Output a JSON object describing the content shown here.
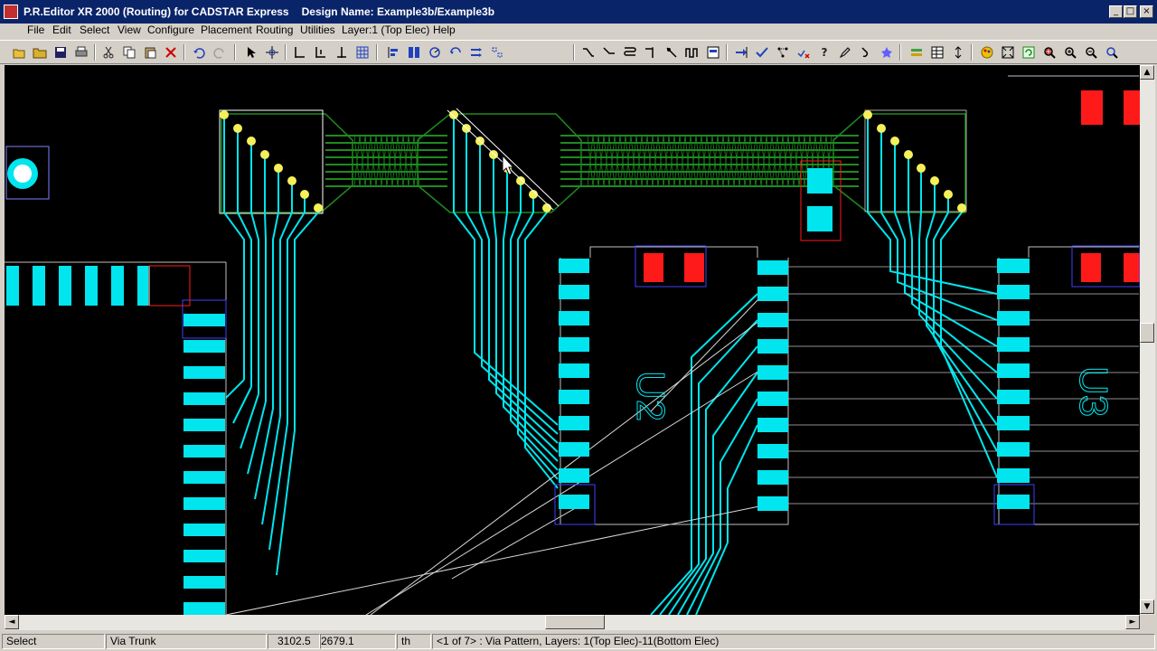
{
  "window": {
    "title": "P.R.Editor XR 2000 (Routing) for CADSTAR Express",
    "design_label": "Design Name: Example3b/Example3b",
    "minimize": "_",
    "maximize": "□",
    "close": "×"
  },
  "menu": [
    {
      "label": "File"
    },
    {
      "label": "Edit"
    },
    {
      "label": "Select"
    },
    {
      "label": "View"
    },
    {
      "label": "Configure"
    },
    {
      "label": "Placement"
    },
    {
      "label": "Routing"
    },
    {
      "label": "Utilities"
    },
    {
      "label": "Layer:1 (Top Elec)"
    },
    {
      "label": "Help"
    }
  ],
  "toolbar_icons": [
    "open-icon",
    "folder-icon",
    "save-icon",
    "print-icon",
    "cut-icon",
    "copy-icon",
    "paste-icon",
    "delete-icon",
    "undo-icon",
    "redo-icon",
    "select-arrow-icon",
    "move-icon",
    "dimension-icon",
    "dimension2-icon",
    "dimension3-icon",
    "grid-icon",
    "align-icon",
    "distribute-icon",
    "rotate-icon",
    "mirror-icon",
    "swap-icon",
    "group-icon",
    "route-icon",
    "route-angle-icon",
    "bus-route-icon",
    "corner-icon",
    "pushpin-icon",
    "meander-icon",
    "pad-icon",
    "add-trunk-icon",
    "check-icon",
    "ratsnest-icon",
    "drc-icon",
    "help-query-icon",
    "edit-icon",
    "hook-icon",
    "star-icon",
    "layer-icon",
    "table-icon",
    "resize-icon",
    "colour-icon",
    "zoom-all-icon",
    "refresh-icon",
    "zoom-window-icon",
    "zoom-in-icon",
    "zoom-out-icon",
    "zoom-select-icon"
  ],
  "canvas": {
    "background": "#000000",
    "track_color": "#00e5ee",
    "trunk_color": "#1f8a1f",
    "pad_color": "#00e5ee",
    "via_color": "#f5f05a",
    "component_color": "#ff1a1a",
    "outline_color": "#4040ff",
    "labels": {
      "u2": "U2",
      "u3": "U3"
    }
  },
  "status": {
    "mode": "Select",
    "command": "Via Trunk",
    "x": "3102.5",
    "y": "2679.1",
    "units": "th",
    "selection": "<1 of 7> : Via Pattern, Layers: 1(Top Elec)-11(Bottom Elec)"
  },
  "scroll": {
    "left": "◄",
    "right": "►",
    "up": "▲",
    "down": "▼"
  }
}
